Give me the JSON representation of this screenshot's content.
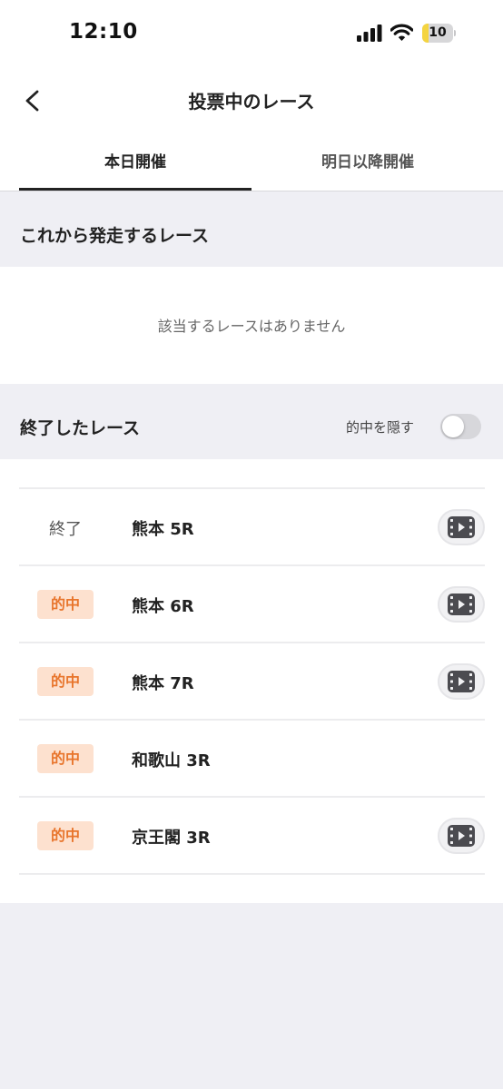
{
  "status_bar": {
    "time": "12:10",
    "battery_level": 10
  },
  "header": {
    "title": "投票中のレース",
    "back_icon": "chevron-left-icon"
  },
  "tabs": [
    {
      "label": "本日開催",
      "selected": true
    },
    {
      "label": "明日以降開催",
      "selected": false
    }
  ],
  "upcoming": {
    "title": "これから発走するレース",
    "empty_message": "該当するレースはありません"
  },
  "finished": {
    "title": "終了したレース",
    "hide_hits_label": "的中を隠す",
    "hide_hits_enabled": false,
    "races": [
      {
        "status": "終了",
        "is_hit": false,
        "name": "熊本 5R",
        "has_video": true
      },
      {
        "status": "的中",
        "is_hit": true,
        "name": "熊本 6R",
        "has_video": true
      },
      {
        "status": "的中",
        "is_hit": true,
        "name": "熊本 7R",
        "has_video": true
      },
      {
        "status": "的中",
        "is_hit": true,
        "name": "和歌山 3R",
        "has_video": false
      },
      {
        "status": "的中",
        "is_hit": true,
        "name": "京王閣 3R",
        "has_video": true
      }
    ]
  },
  "colors": {
    "hit_badge_bg": "#fde1cf",
    "hit_badge_text": "#e8752c",
    "section_bg": "#efeff4",
    "battery_fill": "#f4d440"
  }
}
